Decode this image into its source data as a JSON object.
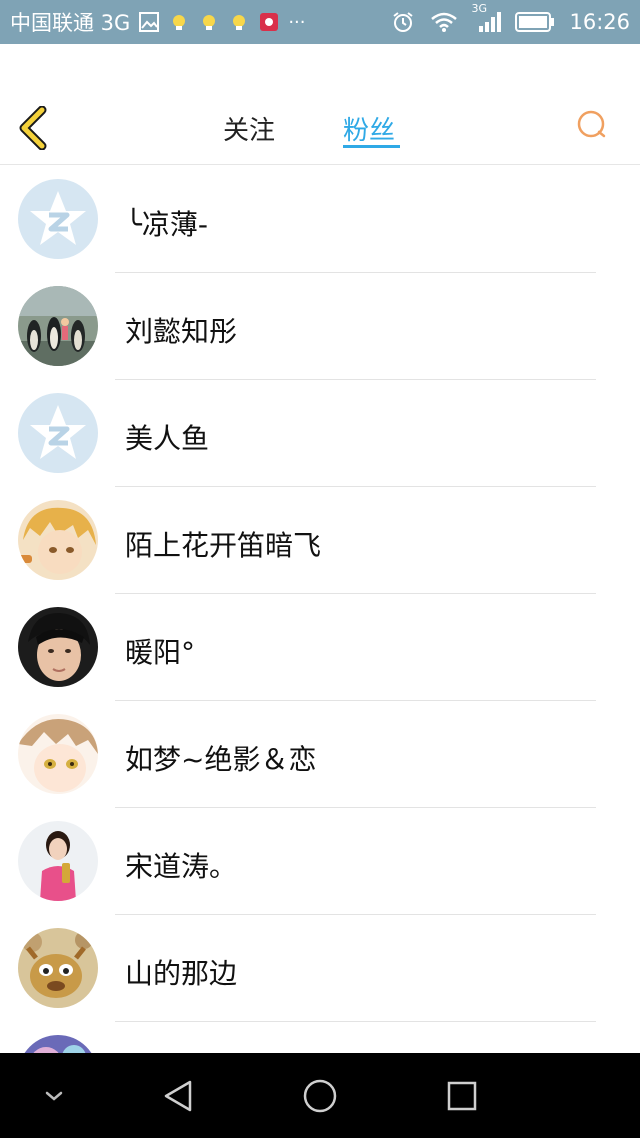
{
  "status_bar": {
    "carrier": "中国联通 3G",
    "time": "16:26",
    "more": "···",
    "network_small": "3G"
  },
  "header": {
    "tabs": [
      {
        "label": "关注",
        "active": false
      },
      {
        "label": "粉丝",
        "active": true
      }
    ]
  },
  "fans": [
    {
      "name": "╰凉薄-",
      "avatar": "default-qzone"
    },
    {
      "name": "刘懿知彤",
      "avatar": "penguins"
    },
    {
      "name": "美人鱼",
      "avatar": "default-qzone"
    },
    {
      "name": "陌上花开笛暗飞",
      "avatar": "anime-blond"
    },
    {
      "name": "暖阳°",
      "avatar": "boy-photo"
    },
    {
      "name": "如梦~绝影＆恋",
      "avatar": "anime-girl"
    },
    {
      "name": "宋道涛。",
      "avatar": "woman-pink"
    },
    {
      "name": "山的那边",
      "avatar": "cartoon-dog"
    },
    {
      "name": "",
      "avatar": "colorful-partial"
    }
  ],
  "colors": {
    "status_bar": "#7fa3b5",
    "accent": "#2fa9e6",
    "back_arrow": "#f1c40f",
    "search": "#f0a060"
  }
}
